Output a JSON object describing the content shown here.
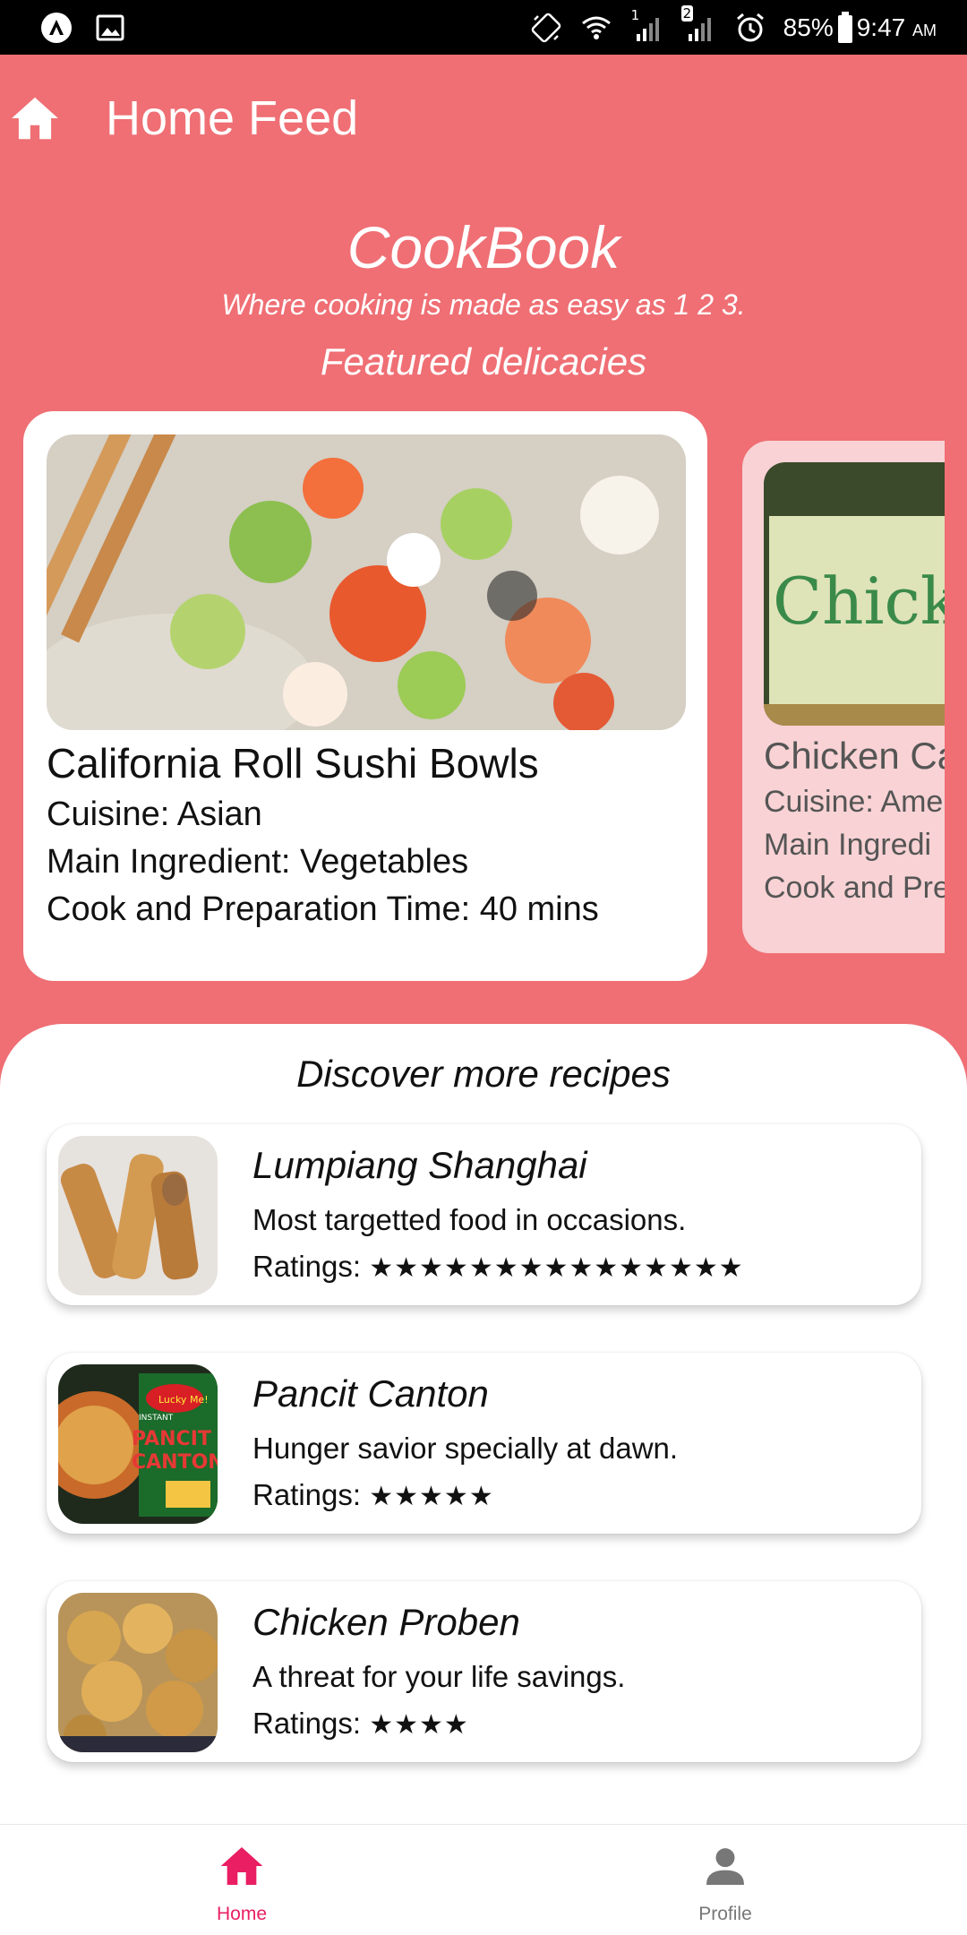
{
  "status_bar": {
    "battery": "85%",
    "time": "9:47",
    "ampm": "AM",
    "icons": [
      "app-logo-icon",
      "gallery-icon",
      "screen-rotate-icon",
      "wifi-icon",
      "signal-1-icon",
      "signal-2-icon",
      "alarm-icon",
      "battery-icon"
    ],
    "sim1": "1",
    "sim2": "2"
  },
  "app_bar": {
    "title": "Home Feed",
    "icon": "home-icon"
  },
  "hero": {
    "brand": "CookBook",
    "tagline": "Where cooking is made as easy as 1 2 3.",
    "featured_title": "Featured delicacies"
  },
  "featured": [
    {
      "title": "California Roll Sushi Bowls",
      "cuisine": "Cuisine: Asian",
      "ingredient": "Main Ingredient: Vegetables",
      "time": "Cook and Preparation Time: 40 mins"
    },
    {
      "title": "Chicken Ca",
      "cuisine": "Cuisine: Ame",
      "ingredient": "Main Ingredi",
      "time": "Cook and Pre",
      "image_text": "Chicke"
    }
  ],
  "discover": {
    "title": "Discover more recipes",
    "recipes": [
      {
        "name": "Lumpiang Shanghai",
        "desc": "Most targetted food in occasions.",
        "ratings_label": "Ratings:",
        "stars": 15,
        "stars_text": "★★★★★★★★★★★★★★★"
      },
      {
        "name": "Pancit Canton",
        "desc": "Hunger savior specially at dawn.",
        "ratings_label": "Ratings:",
        "stars": 5,
        "stars_text": "★★★★★",
        "pack_brand": "Lucky Me!",
        "pack_small": "INSTANT",
        "pack_line1": "PANCIT",
        "pack_line2": "CANTON"
      },
      {
        "name": "Chicken Proben",
        "desc": "A threat for your life savings.",
        "ratings_label": "Ratings:",
        "stars": 4,
        "stars_text": "★★★★"
      }
    ]
  },
  "bottom_nav": {
    "home": "Home",
    "profile": "Profile"
  },
  "colors": {
    "primary_bg": "#EF6F74",
    "accent_active": "#E91E63",
    "inactive": "#777777",
    "card_secondary": "#F8D2D4"
  }
}
